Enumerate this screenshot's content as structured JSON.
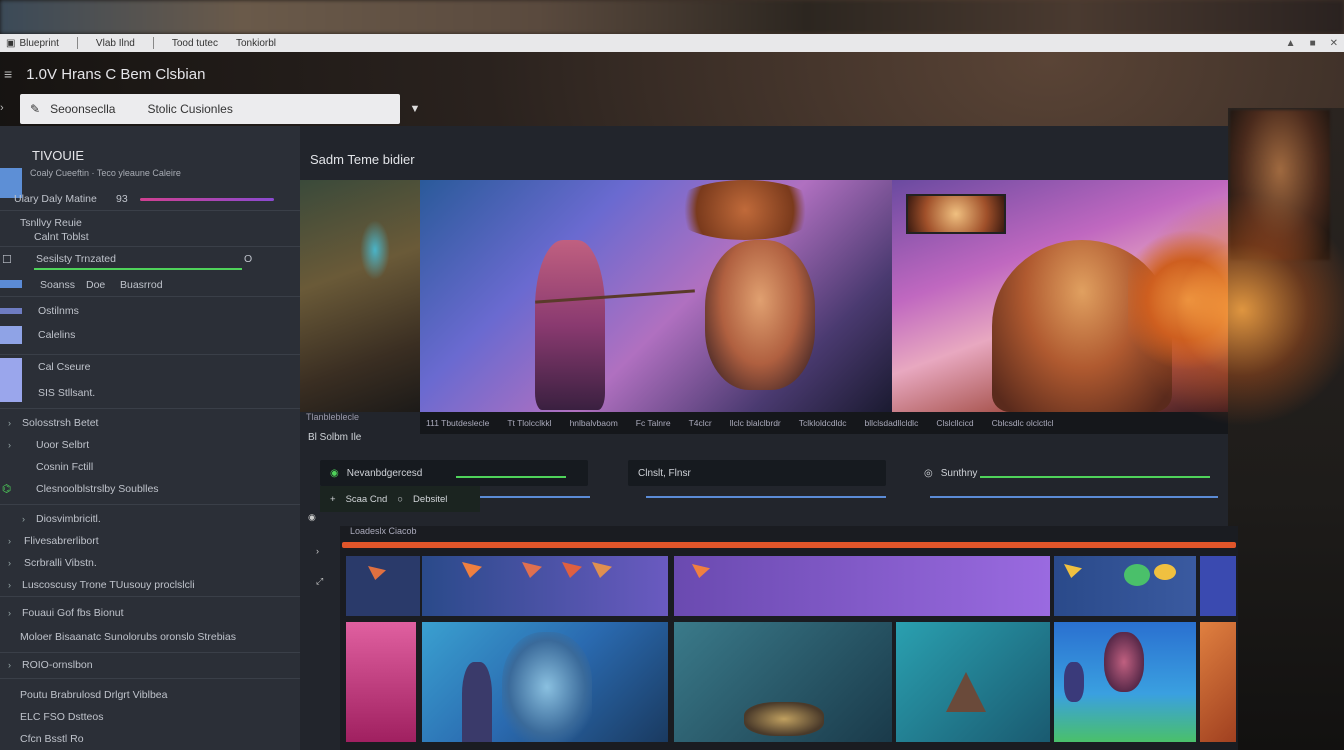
{
  "tabbar": {
    "tabs": [
      "Blueprint",
      "Vlab Ilnd",
      "Tood tutec",
      "Tonkiorbl"
    ],
    "window_icons": [
      "▲",
      "■",
      "✕"
    ]
  },
  "header": {
    "title": "1.0V Hrans C Bem Clsbian"
  },
  "toolbar": {
    "search_value": "Seoonseclla",
    "search_hint": "Stolic Cusionles"
  },
  "sidebar": {
    "section_title": "TIVOUIE",
    "section_sub": "Coaly Cueeftin   ·   Teco yleaune   Caleire",
    "rows": [
      {
        "label": "Ulary Daly Matine",
        "value": "93"
      },
      {
        "label": "Tsnllvy Reuie",
        "value": ""
      },
      {
        "label": "Calnt Toblst",
        "value": ""
      },
      {
        "label": "Sesilsty Trnzated",
        "value": "O"
      },
      {
        "label": "Soanss",
        "value": "Doe"
      },
      {
        "label": "Buasrrod",
        "value": ""
      },
      {
        "label": "Ostilnms",
        "value": ""
      },
      {
        "label": "Calelins",
        "value": ""
      },
      {
        "label": "Cal Cseure",
        "value": ""
      },
      {
        "label": "SIS Stllsant.",
        "value": ""
      },
      {
        "label": "Solosstrsh Betet",
        "value": ""
      },
      {
        "label": "Uoor Selbrt",
        "value": ""
      },
      {
        "label": "Cosnin Fctill",
        "value": ""
      },
      {
        "label": "Clesnoolblstrslby Soublles",
        "value": ""
      },
      {
        "label": "Diosvimbricitl.",
        "value": ""
      },
      {
        "label": "Flivesabrerlibort",
        "value": ""
      },
      {
        "label": "Scrbralli Vibstn.",
        "value": ""
      },
      {
        "label": "Luscoscusy Trone TUusouy proclslcli",
        "value": ""
      },
      {
        "label": "Fouaui Gof fbs Bionut",
        "value": ""
      },
      {
        "label": "Moloer Bisaanatc Sunolorubs oronslo Strebias",
        "value": ""
      },
      {
        "label": "ROIO-ornslbon",
        "value": ""
      },
      {
        "label": "Poutu Brabrulosd Drlgrt Viblbea",
        "value": ""
      },
      {
        "label": "ELC FSO Dstteos",
        "value": ""
      },
      {
        "label": "Cfcn Bsstl Ro",
        "value": ""
      }
    ]
  },
  "viewer": {
    "title": "Sadm Teme bidier",
    "timecodes": [
      "111 Tbutdeslecle",
      "Tt Tlolcclkkl",
      "hnlbalvbaom",
      "Fc Talnre",
      "T4clcr",
      "llclc blalclbrdr",
      "Tclkloldcdldc",
      "bllclsdadllcldlc",
      "Clslcllcicd",
      "Cblcsdlc olclctlcl"
    ],
    "below_left": "Tlanbleblecle"
  },
  "track_controls": {
    "left_label": "Bl Solbm Ile",
    "clip_a": "Nevanbdgercesd",
    "clip_b_icon": "+",
    "clip_b_label": "Scaa Cnd",
    "clip_b_value": "Debsitel",
    "mid": "Clnslt, Flnsr",
    "right": "Sunthny"
  },
  "timeline": {
    "header": "Loadeslx Ciacob"
  },
  "colors": {
    "accent_green": "#4fd35a",
    "accent_blue": "#5b8bd6",
    "playhead_orange": "#e0552a",
    "panel_bg": "#22252c",
    "sidebar_bg": "#2b2f37"
  }
}
